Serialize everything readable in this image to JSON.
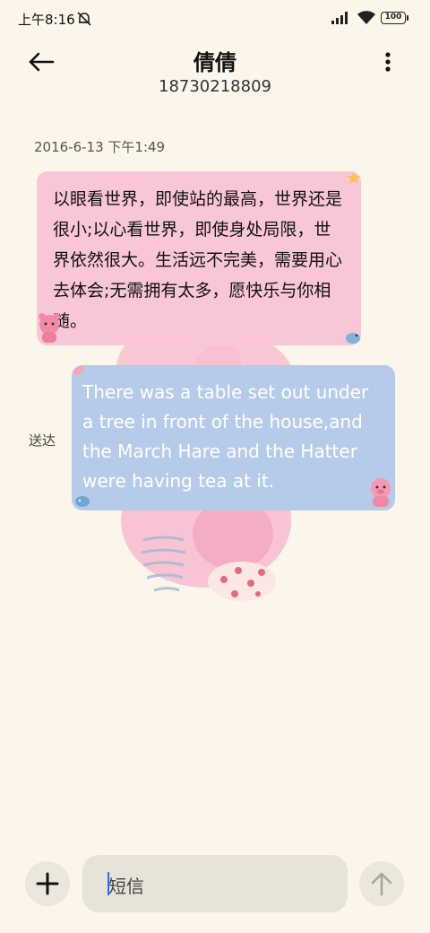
{
  "status_bar": {
    "time": "上午8:16",
    "battery": "100"
  },
  "header": {
    "contact_name": "倩倩",
    "phone_number": "18730218809"
  },
  "conversation": {
    "timestamp": "2016-6-13 下午1:49",
    "messages": [
      {
        "direction": "incoming",
        "text": "以眼看世界，即使站的最高，世界还是很小;以心看世界，即使身处局限，世界依然很大。生活远不完美，需要用心去体会;无需拥有太多，愿快乐与你相随。"
      },
      {
        "direction": "outgoing",
        "text": "There was a table set out under a tree in front of the house,and the March Hare and the Hatter were having tea at it.",
        "status": "送达"
      }
    ]
  },
  "composer": {
    "placeholder": "短信"
  },
  "colors": {
    "background": "#fbf5ea",
    "incoming_bubble": "#f9c6d8",
    "outgoing_bubble": "#b6cbe9",
    "cursor": "#2a6df4"
  },
  "icons": {
    "back": "arrow-left-icon",
    "more": "more-vertical-icon",
    "add": "plus-icon",
    "send": "arrow-up-icon",
    "mute": "bell-off-icon",
    "signal": "signal-icon",
    "wifi": "wifi-icon"
  }
}
